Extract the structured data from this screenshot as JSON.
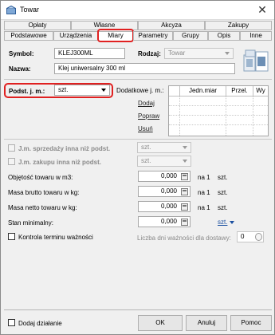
{
  "window": {
    "title": "Towar"
  },
  "tabs_top": [
    "Opłaty",
    "Własne",
    "Akcyza",
    "Zakupy"
  ],
  "tabs_bottom": [
    "Podstawowe",
    "Urządzenia",
    "Miary",
    "Parametry",
    "Grupy",
    "Opis",
    "Inne"
  ],
  "selected_tab": "Miary",
  "header": {
    "symbol_label": "Symbol:",
    "symbol_value": "KLEJ300ML",
    "rodzaj_label": "Rodzaj:",
    "rodzaj_value": "Towar",
    "nazwa_label": "Nazwa:",
    "nazwa_value": "Klej uniwersalny 300 ml"
  },
  "units": {
    "base_label": "Podst. j. m.:",
    "base_value": "szt.",
    "additional_label": "Dodatkowe j. m.:",
    "links": [
      "Dodaj",
      "Popraw",
      "Usuń"
    ],
    "grid_columns": [
      "Jedn.miar",
      "Przel.",
      "Wy"
    ]
  },
  "options": {
    "sale_unit_label": "J.m. sprzedaży inna niż podst.",
    "sale_unit_value": "szt.",
    "purchase_unit_label": "J.m. zakupu inna niż podst.",
    "purchase_unit_value": "szt."
  },
  "measures": [
    {
      "label": "Objętość towaru w m3:",
      "value": "0,000",
      "per": "na 1",
      "unit": "szt."
    },
    {
      "label": "Masa brutto towaru w kg:",
      "value": "0,000",
      "per": "na 1",
      "unit": "szt."
    },
    {
      "label": "Masa netto towaru w kg:",
      "value": "0,000",
      "per": "na 1",
      "unit": "szt."
    }
  ],
  "stock": {
    "label": "Stan minimalny:",
    "value": "0,000",
    "unit_link": "szt."
  },
  "expiry": {
    "label": "Kontrola terminu ważności",
    "days_label": "Liczba dni ważności dla dostawy:",
    "days_value": "0"
  },
  "footer": {
    "add_action": "Dodaj działanie",
    "ok": "OK",
    "cancel": "Anuluj",
    "help": "Pomoc"
  }
}
